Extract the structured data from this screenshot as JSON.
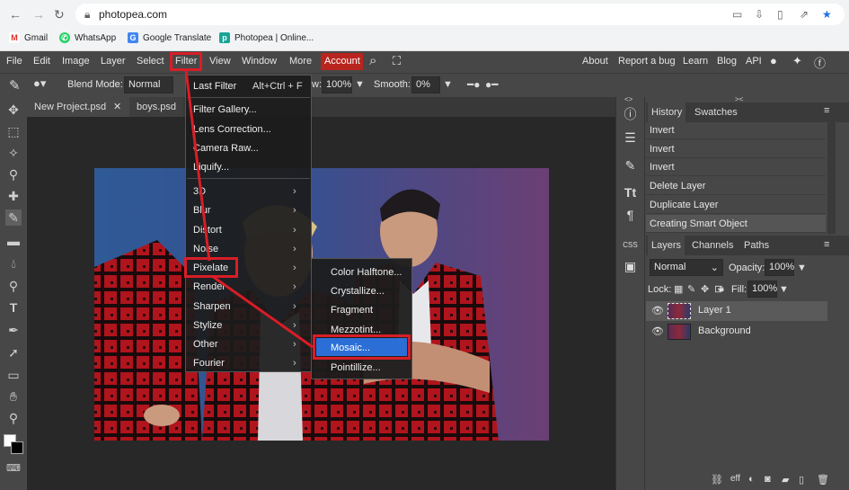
{
  "browser": {
    "url": "photopea.com",
    "bookmarks": [
      {
        "label": "Gmail",
        "icon": "gmail-icon"
      },
      {
        "label": "WhatsApp",
        "icon": "whatsapp-icon"
      },
      {
        "label": "Google Translate",
        "icon": "google-translate-icon"
      },
      {
        "label": "Photopea | Online...",
        "icon": "photopea-icon"
      }
    ]
  },
  "menubar": {
    "items": [
      "File",
      "Edit",
      "Image",
      "Layer",
      "Select",
      "Filter",
      "View",
      "Window",
      "More"
    ],
    "account": "Account",
    "right": [
      "About",
      "Report a bug",
      "Learn",
      "Blog",
      "API"
    ]
  },
  "options": {
    "blend_label": "Blend Mode:",
    "blend_value": "Normal",
    "flow_label": "w:",
    "flow_value": "100%",
    "smooth_label": "Smooth:",
    "smooth_value": "0%"
  },
  "tabs": [
    {
      "label": "New Project.psd",
      "close": "✕"
    },
    {
      "label": "boys.psd"
    }
  ],
  "filter_menu": {
    "items": [
      "Last Filter",
      "Filter Gallery...",
      "Lens Correction...",
      "Camera Raw...",
      "Liquify...",
      "3D",
      "Blur",
      "Distort",
      "Noise",
      "Pixelate",
      "Render",
      "Sharpen",
      "Stylize",
      "Other",
      "Fourier"
    ],
    "last_filter_shortcut": "Alt+Ctrl + F"
  },
  "pixelate_submenu": {
    "items": [
      "Color Halftone...",
      "Crystallize...",
      "Fragment",
      "Mezzotint...",
      "Mosaic...",
      "Pointillize..."
    ]
  },
  "history_panel": {
    "tabs": [
      "History",
      "Swatches"
    ],
    "items": [
      "Invert",
      "Invert",
      "Invert",
      "Delete Layer",
      "Duplicate Layer",
      "Creating Smart Object"
    ]
  },
  "layers_panel": {
    "tabs": [
      "Layers",
      "Channels",
      "Paths"
    ],
    "blend_value": "Normal",
    "opacity_label": "Opacity:",
    "opacity_value": "100%",
    "lock_label": "Lock:",
    "fill_label": "Fill:",
    "fill_value": "100%",
    "layers": [
      "Layer 1",
      "Background"
    ]
  },
  "colors": {
    "accent_red": "#d81e27",
    "highlight_blue": "#2b6fd6",
    "account_red": "#b8241e"
  }
}
